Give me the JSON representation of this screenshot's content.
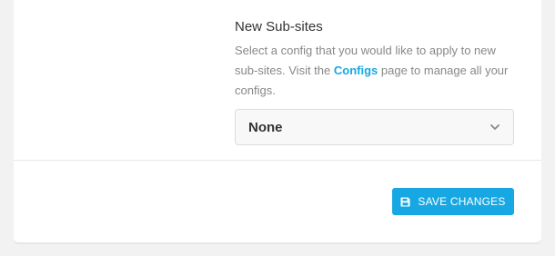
{
  "new_subsites": {
    "title": "New Sub-sites",
    "description_before": "Select a config that you would like to apply to new sub-sites. Visit the ",
    "configs_link": "Configs",
    "description_after": " page to manage all your configs.",
    "select_value": "None"
  },
  "footer": {
    "save_label": "SAVE CHANGES"
  },
  "colors": {
    "accent": "#17a8e3",
    "background": "#f2f2f2",
    "card": "#ffffff"
  },
  "icons": {
    "select": "chevron-down-icon",
    "save": "floppy-disk-icon"
  }
}
